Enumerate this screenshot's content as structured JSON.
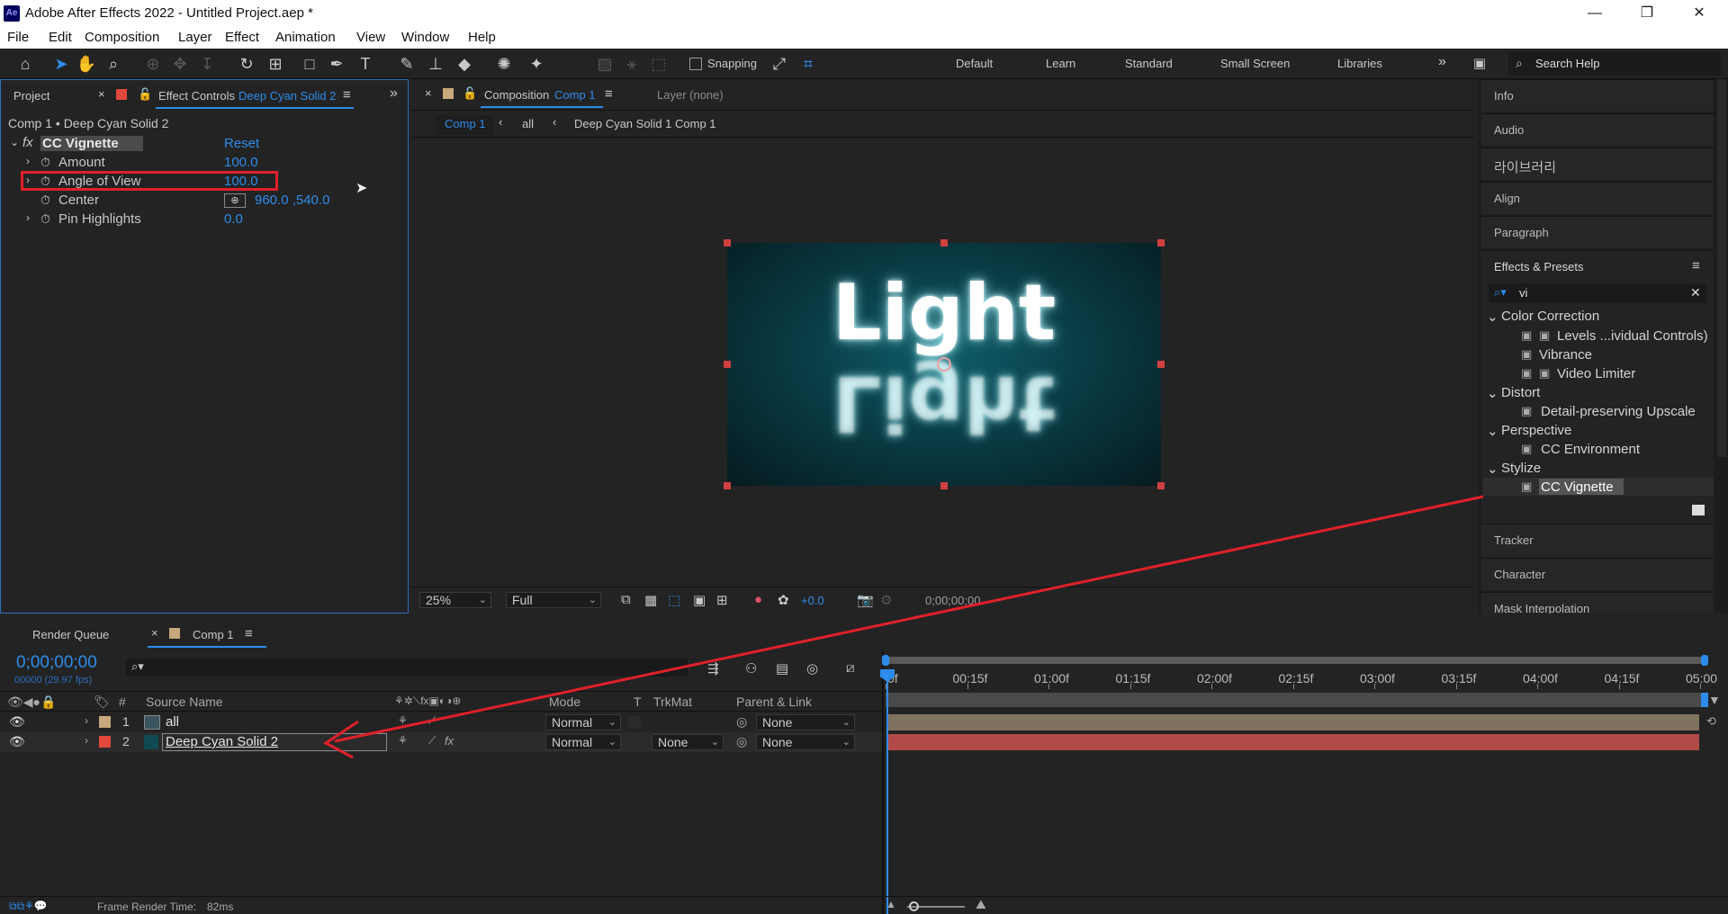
{
  "window": {
    "title": "Adobe After Effects 2022 - Untitled Project.aep *",
    "app_icon": "Ae"
  },
  "menu": [
    "File",
    "Edit",
    "Composition",
    "Layer",
    "Effect",
    "Animation",
    "View",
    "Window",
    "Help"
  ],
  "toolbar": {
    "snapping_label": "Snapping",
    "workspaces": [
      "Default",
      "Learn",
      "Standard",
      "Small Screen",
      "Libraries"
    ],
    "search_placeholder": "Search Help"
  },
  "left_panel": {
    "tab_project": "Project",
    "tab_effect_controls": "Effect Controls",
    "tab_effect_layer": "Deep Cyan Solid 2",
    "breadcrumb": "Comp 1 • Deep Cyan Solid 2",
    "effect_name": "CC Vignette",
    "reset_label": "Reset",
    "fx_label": "fx",
    "properties": [
      {
        "name": "Amount",
        "value": "100.0"
      },
      {
        "name": "Angle of View",
        "value": "100.0"
      },
      {
        "name": "Center",
        "value": "960.0 ,540.0"
      },
      {
        "name": "Pin Highlights",
        "value": "0.0"
      }
    ]
  },
  "composition": {
    "tab_label": "Composition",
    "tab_comp": "Comp 1",
    "layer_tab": "Layer (none)",
    "breadcrumbs": [
      "Comp 1",
      "all",
      "Deep Cyan Solid 1 Comp 1"
    ],
    "preview_text": "Light",
    "zoom": "25%",
    "resolution": "Full",
    "exposure": "+0.0",
    "timecode": "0;00;00;00"
  },
  "right_panel": {
    "items_top": [
      "Info",
      "Audio",
      "라이브러리",
      "Align",
      "Paragraph"
    ],
    "effects_title": "Effects & Presets",
    "search_value": "vi",
    "tree": [
      {
        "category": "Color Correction",
        "items": [
          "Levels ...ividual Controls)",
          "Vibrance",
          "Video Limiter"
        ]
      },
      {
        "category": "Distort",
        "items": [
          "Detail-preserving Upscale"
        ]
      },
      {
        "category": "Perspective",
        "items": [
          "CC Environment"
        ]
      },
      {
        "category": "Stylize",
        "items": [
          "CC Vignette"
        ]
      }
    ],
    "items_bottom": [
      "Tracker",
      "Character",
      "Mask Interpolation"
    ]
  },
  "timeline": {
    "tab_render_queue": "Render Queue",
    "tab_comp": "Comp 1",
    "timecode": "0;00;00;00",
    "fps": "00000 (29.97 fps)",
    "headers": {
      "num": "#",
      "source": "Source Name",
      "mode": "Mode",
      "t": "T",
      "trkmat": "TrkMat",
      "parent": "Parent & Link"
    },
    "ruler": [
      "0f",
      "00:15f",
      "01:00f",
      "01:15f",
      "02:00f",
      "02:15f",
      "03:00f",
      "03:15f",
      "04:00f",
      "04:15f",
      "05:00"
    ],
    "layers": [
      {
        "num": "1",
        "name": "all",
        "mode": "Normal",
        "trkmat": "",
        "parent": "None",
        "color": "#c9a77c"
      },
      {
        "num": "2",
        "name": "Deep Cyan Solid 2",
        "mode": "Normal",
        "trkmat": "None",
        "parent": "None",
        "color": "#e0493b"
      }
    ],
    "status": "Frame Render Time:",
    "status_value": "82ms"
  },
  "colors": {
    "accent": "#2d8ceb",
    "highlight": "#e0202a",
    "bar1": "#7f7360",
    "bar2": "#b24b48"
  }
}
